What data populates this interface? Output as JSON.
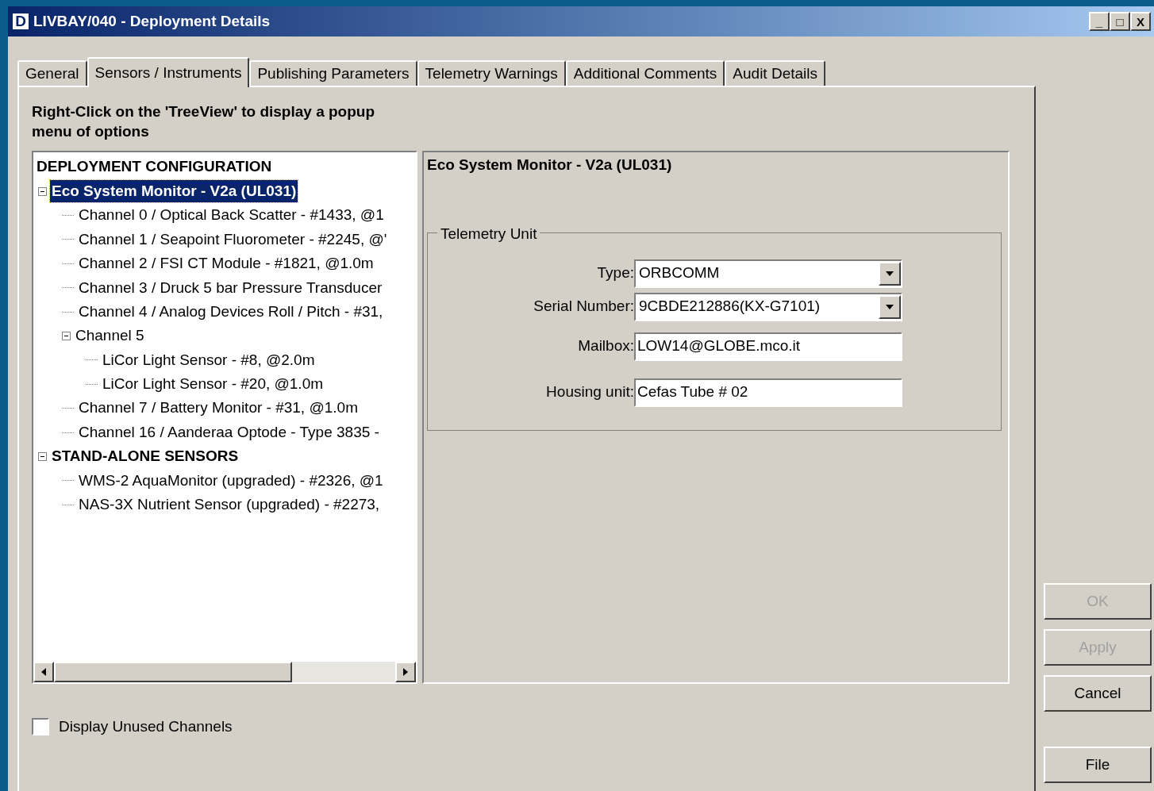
{
  "window": {
    "icon_letter": "D",
    "title": "LIVBAY/040 - Deployment Details",
    "controls": [
      "_",
      "□",
      "X"
    ]
  },
  "tabs": [
    {
      "label": "General",
      "selected": false
    },
    {
      "label": "Sensors / Instruments",
      "selected": true
    },
    {
      "label": "Publishing Parameters",
      "selected": false
    },
    {
      "label": "Telemetry Warnings",
      "selected": false
    },
    {
      "label": "Additional Comments",
      "selected": false
    },
    {
      "label": "Audit Details",
      "selected": false
    }
  ],
  "hint": "Right-Click on the 'TreeView' to display a popup menu of options",
  "tree": {
    "heading": "DEPLOYMENT CONFIGURATION",
    "nodes": [
      {
        "label": "Eco System Monitor - V2a (UL031)",
        "selected": true,
        "expanded": true,
        "children": [
          {
            "label": "Channel 0 / Optical Back Scatter - #1433, @1",
            "selected": false
          },
          {
            "label": "Channel 1 / Seapoint Fluorometer - #2245, @'",
            "selected": false
          },
          {
            "label": "Channel 2 / FSI CT Module - #1821, @1.0m",
            "selected": false
          },
          {
            "label": "Channel 3 / Druck 5 bar Pressure Transducer",
            "selected": false
          },
          {
            "label": "Channel 4 / Analog Devices Roll / Pitch - #31,",
            "selected": false
          },
          {
            "label": "Channel 5",
            "selected": false,
            "expanded": true,
            "children": [
              {
                "label": "LiCor Light Sensor - #8, @2.0m",
                "selected": false
              },
              {
                "label": "LiCor Light Sensor - #20, @1.0m",
                "selected": false
              }
            ]
          },
          {
            "label": "Channel 7 / Battery Monitor - #31, @1.0m",
            "selected": false
          },
          {
            "label": "Channel 16 / Aanderaa Optode - Type 3835 -",
            "selected": false
          }
        ]
      },
      {
        "label": "STAND-ALONE SENSORS",
        "selected": false,
        "expanded": true,
        "children": [
          {
            "label": "WMS-2 AquaMonitor (upgraded) - #2326, @1",
            "selected": false
          },
          {
            "label": "NAS-3X Nutrient Sensor (upgraded) - #2273,",
            "selected": false
          }
        ]
      }
    ]
  },
  "detail": {
    "title": "Eco System Monitor - V2a (UL031)",
    "group": "Telemetry Unit",
    "fields": [
      {
        "kind": "dropdown",
        "label": "Type:",
        "value": "ORBCOMM"
      },
      {
        "kind": "dropdown",
        "label": "Serial Number:",
        "value": "9CBDE212886(KX-G7101)"
      },
      {
        "kind": "text",
        "label": "Mailbox:",
        "value": "LOW14@GLOBE.mco.it"
      },
      {
        "kind": "text",
        "label": "Housing unit:",
        "value": "Cefas Tube # 02"
      }
    ]
  },
  "display_unused": {
    "label": "Display Unused Channels",
    "checked": false
  },
  "buttons": [
    {
      "label": "OK",
      "disabled": true
    },
    {
      "label": "Apply",
      "disabled": true
    },
    {
      "label": "Cancel",
      "disabled": false
    },
    {
      "label": "File",
      "disabled": false
    }
  ]
}
